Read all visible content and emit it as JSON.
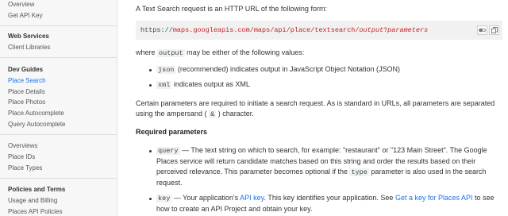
{
  "sidebar": {
    "items_top": [
      "Overview",
      "Get API Key"
    ],
    "web_services_heading": "Web Services",
    "web_services_items": [
      "Client Libraries"
    ],
    "dev_guides_heading": "Dev Guides",
    "dev_guides_items": [
      "Place Search",
      "Place Details",
      "Place Photos",
      "Place Autocomplete",
      "Query Autocomplete"
    ],
    "overviews_heading": "Overviews",
    "overviews_items": [
      "Place IDs",
      "Place Types"
    ],
    "policies_heading": "Policies and Terms",
    "policies_items": [
      "Usage and Billing",
      "Places API Policies"
    ]
  },
  "main": {
    "intro": "A Text Search request is an HTTP URL of the following form:",
    "code": {
      "prefix": "https://",
      "url": "maps.googleapis.com/maps/api/place/textsearch/",
      "output_var": "output",
      "qmark": "?",
      "params_var": "parameters"
    },
    "where_before": "where",
    "where_code": "output",
    "where_after": "may be either of the following values:",
    "formats": [
      {
        "code": "json",
        "text": "(recommended) indicates output in JavaScript Object Notation (JSON)"
      },
      {
        "code": "xml",
        "text": "indicates output as XML"
      }
    ],
    "params_para_before": "Certain parameters are required to initiate a search request. As is standard in URLs, all parameters are separated using the ampersand (",
    "params_para_code": "&",
    "params_para_after": ") character.",
    "required_heading": "Required parameters",
    "query": {
      "name": "query",
      "text_before": "— The text string on which to search, for example: \"restaurant\" or \"123 Main Street\". The Google Places service will return candidate matches based on this string and order the results based on their perceived relevance. This parameter becomes optional if the",
      "code": "type",
      "text_after": "parameter is also used in the search request."
    },
    "key": {
      "name": "key",
      "text1": "— Your application's",
      "link1": "API key",
      "text2": ". This key identifies your application. See",
      "link2": "Get a key for Places API",
      "text3": "to see how to create an API Project and obtain your key."
    }
  }
}
